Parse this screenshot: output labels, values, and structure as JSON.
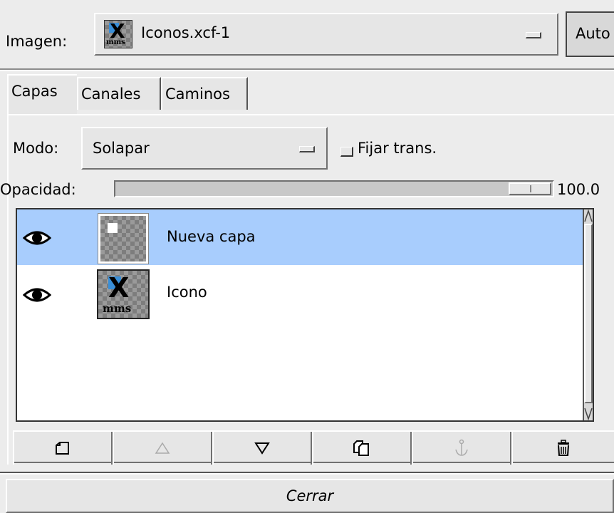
{
  "image_row": {
    "label": "Imagen:",
    "selected_image": "Iconos.xcf-1",
    "auto_button": "Auto"
  },
  "tabs": [
    {
      "label": "Capas",
      "active": true
    },
    {
      "label": "Canales",
      "active": false
    },
    {
      "label": "Caminos",
      "active": false
    }
  ],
  "mode": {
    "label": "Modo:",
    "value": "Solapar",
    "keep_trans_label": "Fijar trans.",
    "keep_trans_checked": false
  },
  "opacity": {
    "label": "Opacidad:",
    "value": "100.0",
    "fraction": 1.0
  },
  "layers": [
    {
      "name": "Nueva capa",
      "visible": true,
      "selected": true,
      "thumb": "white-square"
    },
    {
      "name": "Icono",
      "visible": true,
      "selected": false,
      "thumb": "x-mms-logo"
    }
  ],
  "thumb_text": {
    "logo_x": "X",
    "logo_mms": "mms"
  },
  "toolbar": [
    {
      "icon": "new-layer-icon",
      "enabled": true
    },
    {
      "icon": "raise-layer-icon",
      "enabled": false
    },
    {
      "icon": "lower-layer-icon",
      "enabled": true
    },
    {
      "icon": "duplicate-layer-icon",
      "enabled": true
    },
    {
      "icon": "anchor-layer-icon",
      "enabled": false
    },
    {
      "icon": "delete-layer-icon",
      "enabled": true
    }
  ],
  "close_button": "Cerrar",
  "colors": {
    "background": "#ececec",
    "selection": "#a8cdfd",
    "list_bg": "#ffffff",
    "icon_blue": "#3a8fd8"
  }
}
